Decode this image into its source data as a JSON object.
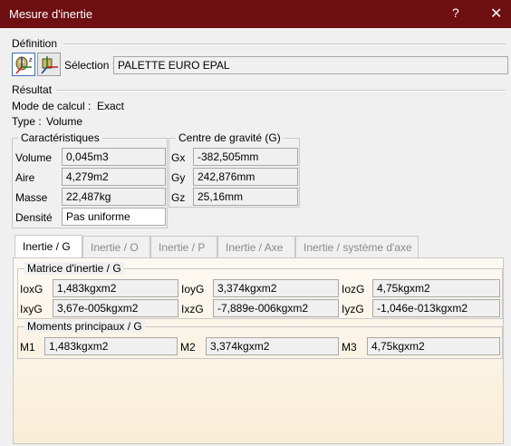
{
  "window": {
    "title": "Mesure d'inertie",
    "help": "?",
    "close": "✕"
  },
  "definition": {
    "heading": "Définition",
    "selection_label": "Sélection :",
    "selection_value": "PALETTE EURO EPAL",
    "icons": [
      "inertia-3d-icon",
      "inertia-2d-icon"
    ]
  },
  "result": {
    "heading": "Résultat",
    "calc_mode_label": "Mode de calcul :",
    "calc_mode_value": "Exact",
    "type_label": "Type :",
    "type_value": "Volume"
  },
  "characteristics": {
    "title": "Caractéristiques",
    "rows": [
      {
        "label": "Volume",
        "value": "0,045m3"
      },
      {
        "label": "Aire",
        "value": "4,279m2"
      },
      {
        "label": "Masse",
        "value": "22,487kg"
      },
      {
        "label": "Densité",
        "value": "Pas uniforme"
      }
    ]
  },
  "gravity_center": {
    "title": "Centre de gravité (G)",
    "rows": [
      {
        "label": "Gx",
        "value": "-382,505mm"
      },
      {
        "label": "Gy",
        "value": "242,876mm"
      },
      {
        "label": "Gz",
        "value": "25,16mm"
      }
    ]
  },
  "tabs": [
    {
      "label": "Inertie / G",
      "active": true
    },
    {
      "label": "Inertie / O",
      "active": false
    },
    {
      "label": "Inertie / P",
      "active": false
    },
    {
      "label": "Inertie / Axe",
      "active": false
    },
    {
      "label": "Inertie / système d'axe",
      "active": false
    }
  ],
  "inertia_matrix": {
    "title": "Matrice d'inertie / G",
    "cells": [
      {
        "label": "IoxG",
        "value": "1,483kgxm2"
      },
      {
        "label": "IoyG",
        "value": "3,374kgxm2"
      },
      {
        "label": "IozG",
        "value": "4,75kgxm2"
      },
      {
        "label": "IxyG",
        "value": "3,67e-005kgxm2"
      },
      {
        "label": "IxzG",
        "value": "-7,889e-006kgxm2"
      },
      {
        "label": "IyzG",
        "value": "-1,046e-013kgxm2"
      }
    ]
  },
  "principal_moments": {
    "title": "Moments principaux / G",
    "cells": [
      {
        "label": "M1",
        "value": "1,483kgxm2"
      },
      {
        "label": "M2",
        "value": "3,374kgxm2"
      },
      {
        "label": "M3",
        "value": "4,75kgxm2"
      }
    ]
  }
}
